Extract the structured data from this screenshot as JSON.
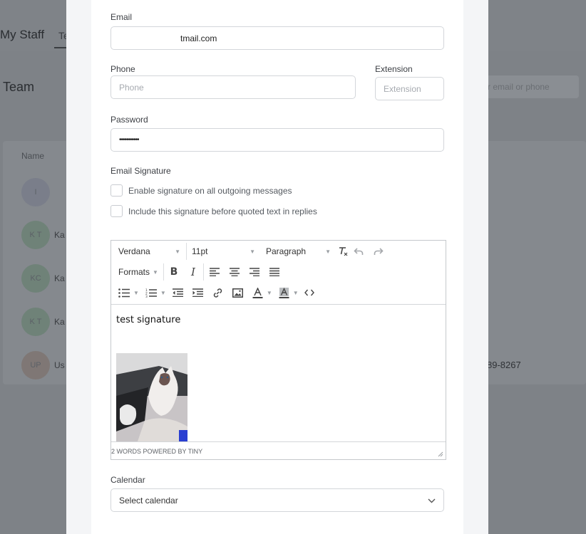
{
  "background": {
    "page_title": "My Staff",
    "tab_partial": "Te",
    "section_title": "Team",
    "search_placeholder": "r email or phone",
    "table_header_name": "Name",
    "rows": [
      {
        "initials": "I",
        "name": ""
      },
      {
        "initials": "K T",
        "name": "Ka"
      },
      {
        "initials": "KC",
        "name": "Ka"
      },
      {
        "initials": "K T",
        "name": "Ka"
      },
      {
        "initials": "UP",
        "name": "Us"
      }
    ],
    "phone_partial": "89-8267"
  },
  "form": {
    "email": {
      "label": "Email",
      "value": "tmail.com"
    },
    "phone": {
      "label": "Phone",
      "placeholder": "Phone"
    },
    "extension": {
      "label": "Extension",
      "placeholder": "Extension"
    },
    "password": {
      "label": "Password",
      "value": "•••••••••••"
    },
    "signature": {
      "label": "Email Signature",
      "enable_label": "Enable signature on all outgoing messages",
      "before_quoted_label": "Include this signature before quoted text in replies"
    },
    "editor": {
      "font_family": "Verdana",
      "font_size": "11pt",
      "block_format": "Paragraph",
      "formats_label": "Formats",
      "content_text": "test signature",
      "image_alt": "cat photo",
      "status_text": "2 WORDS POWERED BY TINY"
    },
    "calendar": {
      "label": "Calendar",
      "value": "Select calendar"
    }
  }
}
